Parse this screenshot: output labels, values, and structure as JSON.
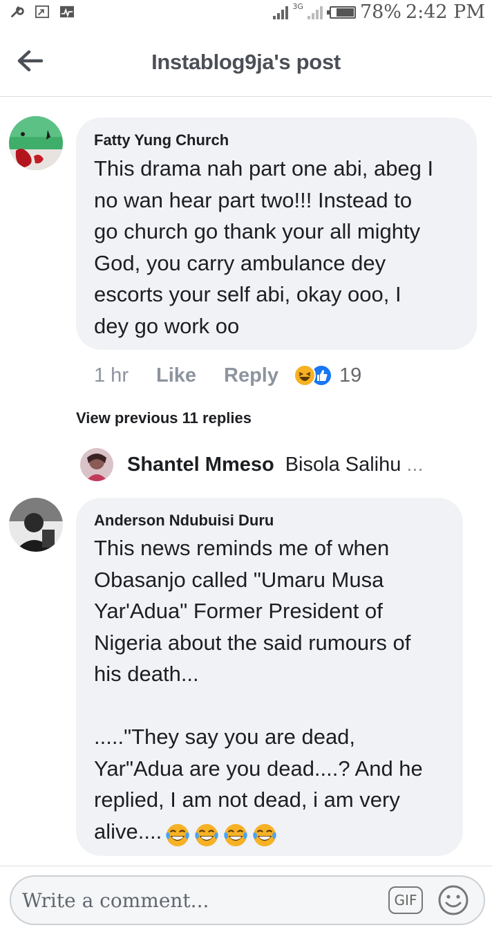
{
  "status_bar": {
    "network": "3G",
    "battery": "78%",
    "battery_level": 0.78,
    "time": "2:42 PM",
    "icons": [
      "wrench-icon",
      "cast-icon",
      "pulse-icon"
    ]
  },
  "header": {
    "title": "Instablog9ja's post",
    "back_icon": "arrow-left-icon"
  },
  "comments": [
    {
      "author": "Fatty Yung Church",
      "text": "This drama nah part one abi, abeg I\nno wan hear part two!!! Instead to\ngo church go thank your all mighty\nGod, you carry ambulance dey\nescorts your self abi, okay ooo, I\ndey go work oo",
      "time": "1 hr",
      "like_label": "Like",
      "reply_label": "Reply",
      "reaction_count": "19",
      "reactions": [
        "haha",
        "like"
      ]
    },
    {
      "author": "Anderson Ndubuisi Duru",
      "text": "This news reminds me of when\nObasanjo called \"Umaru Musa\nYar'Adua\" Former President of\nNigeria about the said rumours of\nhis death...\n\n.....\"They say you are dead,\nYar\"Adua are you dead....? And he\nreplied, I am not dead, i am very\nalive....",
      "emoji_count": 4,
      "emoji_icon": "tears-of-joy-emoji"
    }
  ],
  "view_previous": "View previous 11 replies",
  "reply_preview": {
    "name": "Shantel Mmeso",
    "snippet": "Bisola Salihu",
    "ellipsis": "..."
  },
  "composer": {
    "placeholder": "Write a comment...",
    "gif_label": "GIF",
    "emoji_icon": "smiley-icon"
  },
  "colors": {
    "bubble": "#f0f2f5",
    "muted": "#8d949e",
    "like_blue": "#1877f2",
    "haha_yellow": "#f7b125"
  }
}
